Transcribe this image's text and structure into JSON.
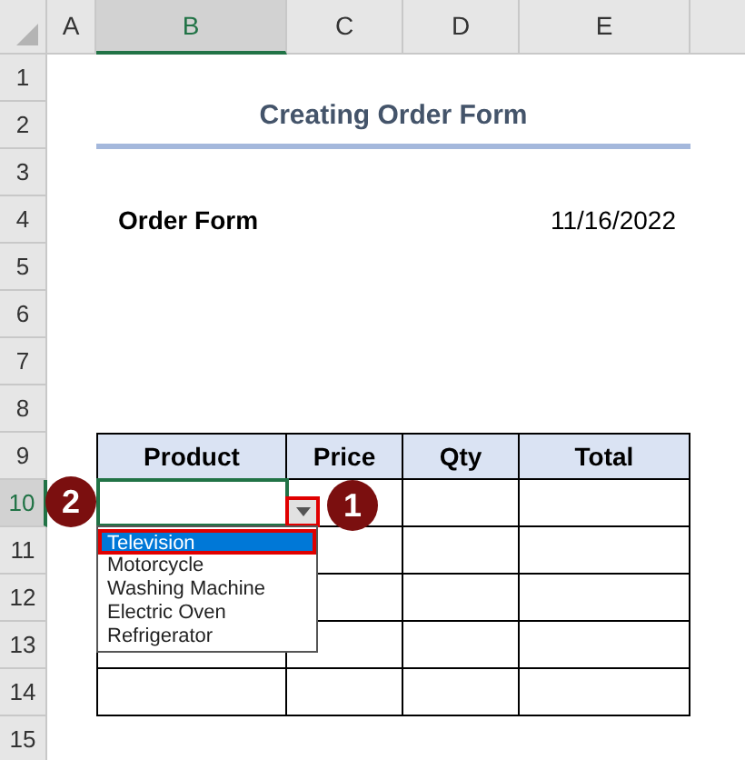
{
  "column_headers": [
    {
      "label": "A",
      "selected": false
    },
    {
      "label": "B",
      "selected": true
    },
    {
      "label": "C",
      "selected": false
    },
    {
      "label": "D",
      "selected": false
    },
    {
      "label": "E",
      "selected": false
    }
  ],
  "row_headers": [
    {
      "label": "1",
      "selected": false
    },
    {
      "label": "2",
      "selected": false
    },
    {
      "label": "3",
      "selected": false
    },
    {
      "label": "4",
      "selected": false
    },
    {
      "label": "5",
      "selected": false
    },
    {
      "label": "6",
      "selected": false
    },
    {
      "label": "7",
      "selected": false
    },
    {
      "label": "8",
      "selected": false
    },
    {
      "label": "9",
      "selected": false
    },
    {
      "label": "10",
      "selected": true
    },
    {
      "label": "11",
      "selected": false
    },
    {
      "label": "12",
      "selected": false
    },
    {
      "label": "13",
      "selected": false
    },
    {
      "label": "14",
      "selected": false
    },
    {
      "label": "15",
      "selected": false
    }
  ],
  "title": "Creating Order Form",
  "order_label": "Order Form",
  "order_date": "11/16/2022",
  "table": {
    "columns": [
      "Product",
      "Price",
      "Qty",
      "Total"
    ]
  },
  "dropdown": {
    "items": [
      {
        "label": "Television",
        "selected": true
      },
      {
        "label": "Motorcycle",
        "selected": false
      },
      {
        "label": "Washing Machine",
        "selected": false
      },
      {
        "label": "Electric Oven",
        "selected": false
      },
      {
        "label": "Refrigerator",
        "selected": false
      }
    ]
  },
  "callouts": [
    "2",
    "1"
  ]
}
